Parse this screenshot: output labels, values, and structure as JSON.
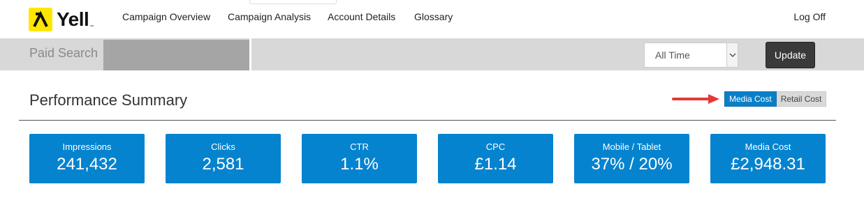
{
  "brand": {
    "name": "Yell",
    "tm": "™"
  },
  "nav": {
    "items": [
      "Campaign Overview",
      "Campaign Analysis",
      "Account Details",
      "Glossary"
    ],
    "logoff": "Log Off"
  },
  "subbar": {
    "title": "Paid Search",
    "date_select_value": "All Time",
    "update_label": "Update"
  },
  "summary": {
    "title": "Performance Summary",
    "toggle": {
      "active": "Media Cost",
      "inactive": "Retail Cost"
    },
    "accent_color": "#0583cf"
  },
  "tiles": [
    {
      "label": "Impressions",
      "value": "241,432"
    },
    {
      "label": "Clicks",
      "value": "2,581"
    },
    {
      "label": "CTR",
      "value": "1.1%"
    },
    {
      "label": "CPC",
      "value": "£1.14"
    },
    {
      "label": "Mobile / Tablet",
      "value": "37% / 20%"
    },
    {
      "label": "Media Cost",
      "value": "£2,948.31"
    }
  ]
}
